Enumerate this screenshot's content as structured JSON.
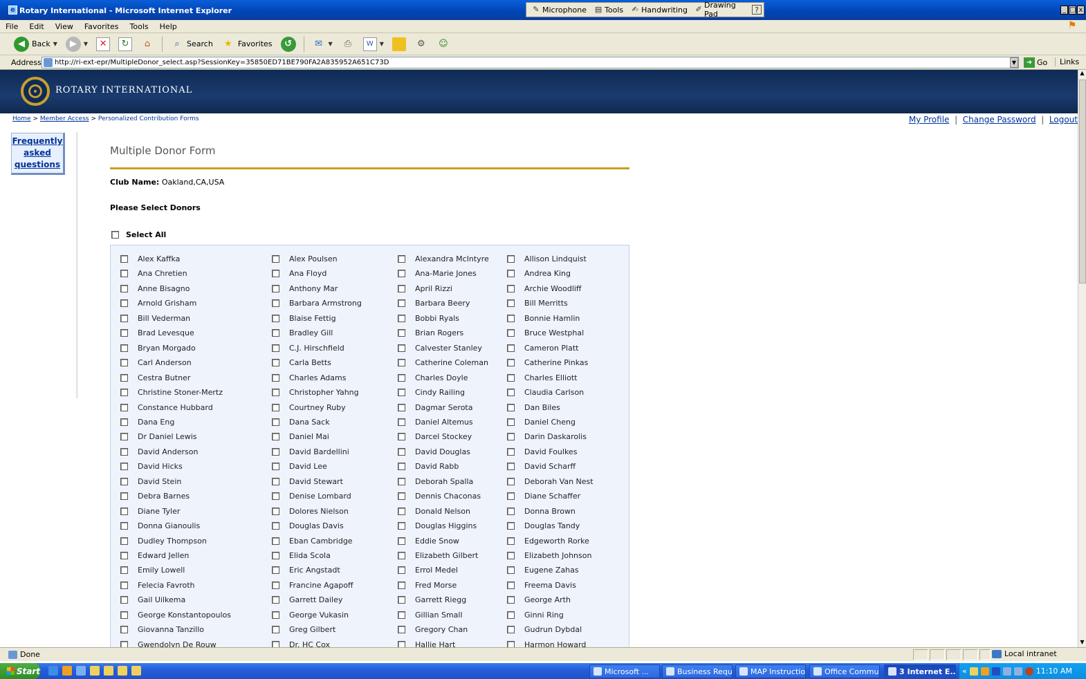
{
  "window": {
    "title": "Rotary International - Microsoft Internet Explorer",
    "controls": [
      "_",
      "□",
      "x"
    ]
  },
  "langbar": {
    "items": [
      {
        "icon": "microphone-icon",
        "label": "Microphone"
      },
      {
        "icon": "tools-icon",
        "label": "Tools"
      },
      {
        "icon": "handwriting-icon",
        "label": "Handwriting"
      },
      {
        "icon": "drawing-pad-icon",
        "label": "Drawing Pad"
      },
      {
        "icon": "help-icon",
        "label": "?"
      }
    ]
  },
  "menu": [
    "File",
    "Edit",
    "View",
    "Favorites",
    "Tools",
    "Help"
  ],
  "toolbar": {
    "back": "Back",
    "search": "Search",
    "favorites": "Favorites"
  },
  "address": {
    "label": "Address",
    "url": "http://ri-ext-epr/MultipleDonor_select.asp?SessionKey=35850ED71BE790FA2A835952A651C73D",
    "go": "Go",
    "links": "Links"
  },
  "site": {
    "brand": "ROTARY INTERNATIONAL"
  },
  "breadcrumb": {
    "home": "Home",
    "member_access": "Member Access",
    "current": "Personalized Contribution Forms"
  },
  "toplinks": {
    "profile": "My Profile",
    "password": "Change Password",
    "logout": "Logout"
  },
  "faq": {
    "line1": "Frequently",
    "line2": "asked",
    "line3": "questions"
  },
  "form": {
    "title": "Multiple Donor Form",
    "club_label": "Club Name:",
    "club_value": "Oakland,CA,USA",
    "select_prompt": "Please Select Donors",
    "select_all": "Select All"
  },
  "donors": [
    [
      "Alex Kaffka",
      "Alex Poulsen",
      "Alexandra McIntyre",
      "Allison Lindquist"
    ],
    [
      "Ana Chretien",
      "Ana Floyd",
      "Ana-Marie Jones",
      "Andrea King"
    ],
    [
      "Anne Bisagno",
      "Anthony Mar",
      "April Rizzi",
      "Archie Woodliff"
    ],
    [
      "Arnold Grisham",
      "Barbara Armstrong",
      "Barbara Beery",
      "Bill Merritts"
    ],
    [
      "Bill Vederman",
      "Blaise Fettig",
      "Bobbi Ryals",
      "Bonnie Hamlin"
    ],
    [
      "Brad Levesque",
      "Bradley Gill",
      "Brian Rogers",
      "Bruce Westphal"
    ],
    [
      "Bryan Morgado",
      "C.J. Hirschfield",
      "Calvester Stanley",
      "Cameron Platt"
    ],
    [
      "Carl Anderson",
      "Carla Betts",
      "Catherine Coleman",
      "Catherine Pinkas"
    ],
    [
      "Cestra Butner",
      "Charles Adams",
      "Charles Doyle",
      "Charles Elliott"
    ],
    [
      "Christine Stoner-Mertz",
      "Christopher Yahng",
      "Cindy Railing",
      "Claudia Carlson"
    ],
    [
      "Constance Hubbard",
      "Courtney Ruby",
      "Dagmar Serota",
      "Dan Biles"
    ],
    [
      "Dana Eng",
      "Dana Sack",
      "Daniel Altemus",
      "Daniel Cheng"
    ],
    [
      "Dr Daniel Lewis",
      "Daniel Mai",
      "Darcel Stockey",
      "Darin Daskarolis"
    ],
    [
      "David Anderson",
      "David Bardellini",
      "David Douglas",
      "David Foulkes"
    ],
    [
      "David Hicks",
      "David Lee",
      "David Rabb",
      "David Scharff"
    ],
    [
      "David Stein",
      "David Stewart",
      "Deborah Spalla",
      "Deborah Van Nest"
    ],
    [
      "Debra Barnes",
      "Denise Lombard",
      "Dennis Chaconas",
      "Diane Schaffer"
    ],
    [
      "Diane Tyler",
      "Dolores Nielson",
      "Donald Nelson",
      "Donna Brown"
    ],
    [
      "Donna Gianoulis",
      "Douglas Davis",
      "Douglas Higgins",
      "Douglas Tandy"
    ],
    [
      "Dudley Thompson",
      "Eban Cambridge",
      "Eddie Snow",
      "Edgeworth Rorke"
    ],
    [
      "Edward Jellen",
      "Elida Scola",
      "Elizabeth Gilbert",
      "Elizabeth Johnson"
    ],
    [
      "Emily Lowell",
      "Eric Angstadt",
      "Errol Medel",
      "Eugene Zahas"
    ],
    [
      "Felecia Favroth",
      "Francine Agapoff",
      "Fred Morse",
      "Freema Davis"
    ],
    [
      "Gail Uilkema",
      "Garrett Dailey",
      "Garrett Riegg",
      "George Arth"
    ],
    [
      "George Konstantopoulos",
      "George Vukasin",
      "Gillian Small",
      "Ginni Ring"
    ],
    [
      "Giovanna Tanzillo",
      "Greg Gilbert",
      "Gregory Chan",
      "Gudrun Dybdal"
    ],
    [
      "Gwendolyn De Rouw",
      "Dr. HC Cox",
      "Hallie Hart",
      "Harmon Howard"
    ]
  ],
  "status": {
    "text": "Done",
    "zone": "Local intranet"
  },
  "taskbar": {
    "start": "Start",
    "tasks": [
      "Microsoft ...",
      "Business Requi...",
      "MAP Instructio...",
      "Office Commu...",
      "3 Internet E..."
    ],
    "clock": "11:10 AM",
    "chevron": "«"
  }
}
